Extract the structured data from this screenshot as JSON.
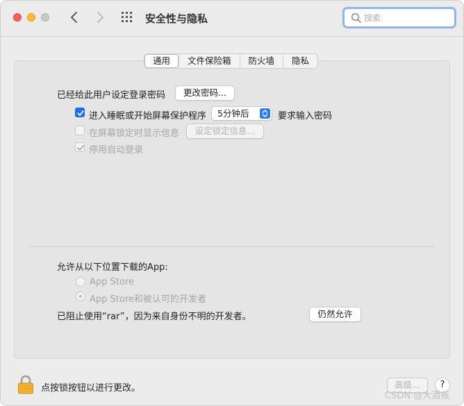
{
  "window": {
    "title": "安全性与隐私",
    "search_placeholder": "搜索",
    "traffic_lights": [
      "close",
      "minimize",
      "zoom"
    ],
    "nav_icons": [
      "chevron-left-icon",
      "chevron-right-icon",
      "grid-icon"
    ]
  },
  "tabs": [
    {
      "label": "通用",
      "active": true
    },
    {
      "label": "文件保险箱",
      "active": false
    },
    {
      "label": "防火墙",
      "active": false
    },
    {
      "label": "隐私",
      "active": false
    }
  ],
  "general": {
    "password_set_label": "已经给此用户设定登录密码",
    "change_password_button": "更改密码...",
    "require_password": {
      "checked": true,
      "label_prefix": "进入睡眠或开始屏幕保护程序",
      "delay_value": "5分钟后",
      "label_suffix": "要求输入密码"
    },
    "show_message": {
      "checked": false,
      "enabled": false,
      "label": "在屏幕锁定时显示信息",
      "button": "设定锁定信息..."
    },
    "disable_auto_login": {
      "checked": true,
      "enabled": false,
      "label": "停用自动登录"
    }
  },
  "downloads": {
    "heading": "允许从以下位置下载的App:",
    "options": [
      {
        "label": "App Store",
        "selected": false,
        "enabled": false
      },
      {
        "label": "App Store和被认可的开发者",
        "selected": true,
        "enabled": false
      }
    ],
    "blocked_message": "已阻止使用“rar”，因为来自身份不明的开发者。",
    "allow_anyway_button": "仍然允许"
  },
  "footer": {
    "lock_text": "点按锁按钮以进行更改。",
    "advanced_button": "高级...",
    "help_label": "?",
    "watermark": "CSDN @大酒瓶"
  },
  "colors": {
    "accent": "#1a72e8",
    "close": "#fe5f57",
    "minimize": "#febc2e",
    "search_focus": "#8fb5ea"
  }
}
